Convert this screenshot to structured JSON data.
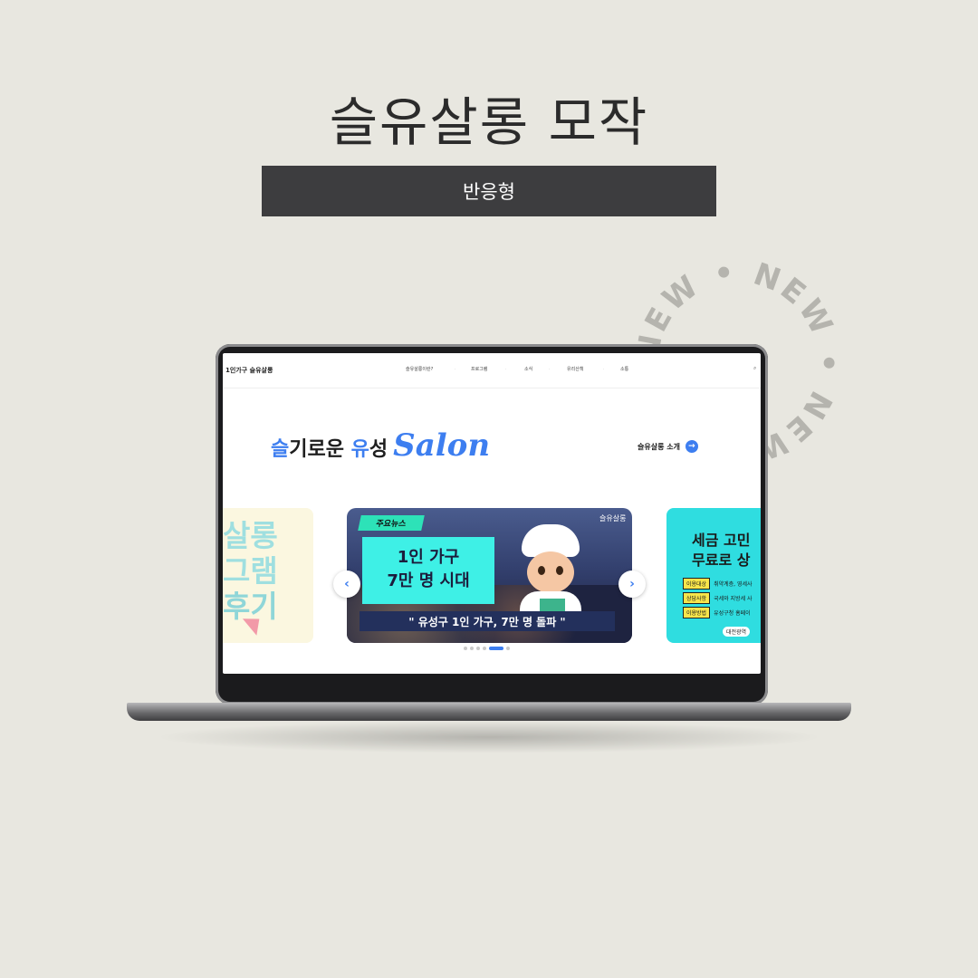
{
  "page": {
    "title": "슬유살롱 모작",
    "tag": "반응형",
    "badge_text": "NEW • NEW • NEW • NEW •"
  },
  "site": {
    "logo": "1인가구 슬유살롱",
    "nav": [
      "슬유살롱이란?",
      "프로그램",
      "소식",
      "유리산책",
      "소통"
    ],
    "search_icon": "search-icon",
    "hero": {
      "part1": "슬",
      "part2": "기로운 ",
      "part3": "유",
      "part4": "성",
      "script": "Salon"
    },
    "intro_link": "슬유살롱 소개"
  },
  "slides": {
    "left": {
      "lines": [
        "살롱",
        "그램",
        "후기"
      ]
    },
    "main": {
      "tag": "주요뉴스",
      "headline_1": "1인 가구",
      "headline_2": "7만 명 시대",
      "quote": "\" 유성구 1인 가구, 7만 명 돌파 \"",
      "seal": "슬유살롱"
    },
    "right": {
      "title_1": "세금 고민",
      "title_2": "무료로 상",
      "rows": [
        {
          "key": "이용대상",
          "value": "취약계층, 영세사"
        },
        {
          "key": "상담사항",
          "value": "국세와 지방세 사"
        },
        {
          "key": "이용방법",
          "value": "유성구청 홈페이"
        }
      ],
      "org": "대전광역"
    },
    "prev": "‹",
    "next": "›",
    "dot_count": 6,
    "active_dot": 4
  },
  "colors": {
    "accent": "#3d7ef0",
    "background": "#e8e7e0",
    "tag_bar": "#3d3d3f",
    "news_tag": "#2de2b8",
    "headline_bg": "#3ef0e6"
  }
}
